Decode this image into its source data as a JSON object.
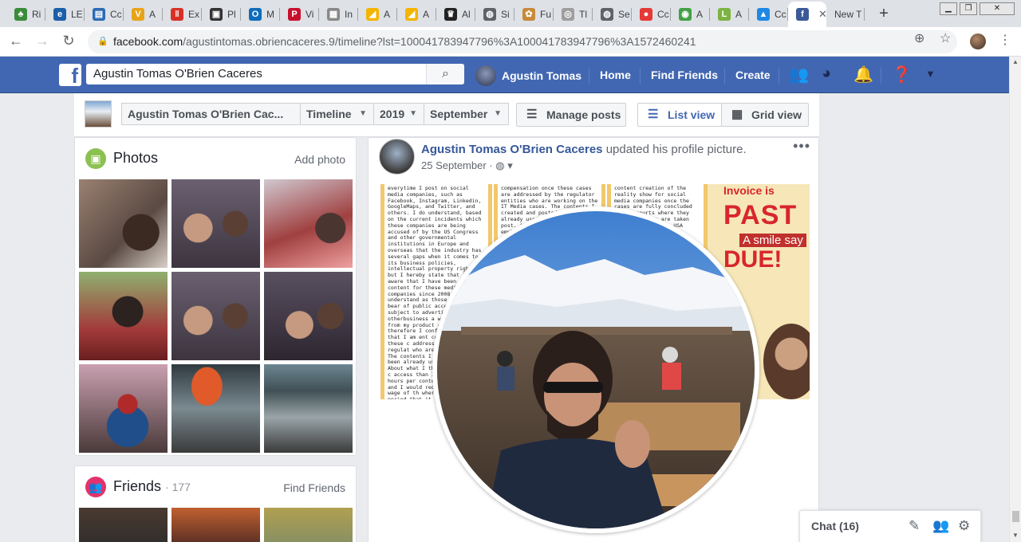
{
  "browser": {
    "tabs": [
      {
        "label": "Ri",
        "color": "#3b8b3b",
        "glyph": "♣"
      },
      {
        "label": "LE",
        "color": "#1c5fa8",
        "glyph": "e"
      },
      {
        "label": "Cc",
        "color": "#2b6bb4",
        "glyph": "▤"
      },
      {
        "label": "A",
        "color": "#e8a317",
        "glyph": "V"
      },
      {
        "label": "Ex",
        "color": "#d93025",
        "glyph": "‖"
      },
      {
        "label": "Pl",
        "color": "#333333",
        "glyph": "▣"
      },
      {
        "label": "M",
        "color": "#0f6cbd",
        "glyph": "O"
      },
      {
        "label": "Vi",
        "color": "#c8102e",
        "glyph": "P"
      },
      {
        "label": "In",
        "color": "#888888",
        "glyph": "▦"
      },
      {
        "label": "A",
        "color": "#f4b400",
        "glyph": "◢"
      },
      {
        "label": "A",
        "color": "#f4b400",
        "glyph": "◢"
      },
      {
        "label": "Al",
        "color": "#222222",
        "glyph": "♛"
      },
      {
        "label": "Si",
        "color": "#5f6368",
        "glyph": "◍"
      },
      {
        "label": "Fu",
        "color": "#c88a3a",
        "glyph": "✿"
      },
      {
        "label": "Tl",
        "color": "#9e9e9e",
        "glyph": "◎"
      },
      {
        "label": "Se",
        "color": "#5f6368",
        "glyph": "◍"
      },
      {
        "label": "Cc",
        "color": "#e53935",
        "glyph": "●"
      },
      {
        "label": "A",
        "color": "#43a047",
        "glyph": "◉"
      },
      {
        "label": "A",
        "color": "#7cb342",
        "glyph": "L"
      },
      {
        "label": "Cc",
        "color": "#1e88e5",
        "glyph": "▲"
      },
      {
        "label": "",
        "color": "#3b5998",
        "glyph": "f"
      },
      {
        "label": "New T",
        "color": "",
        "glyph": ""
      }
    ],
    "url_host": "facebook.com",
    "url_path": "/agustintomas.obriencaceres.9/timeline?lst=100041783947796%3A100041783947796%3A1572460241",
    "new_tab_glyph": "+"
  },
  "fb": {
    "search_value": "Agustin Tomas O'Brien Caceres",
    "user_name": "Agustin Tomas",
    "nav": [
      "Home",
      "Find Friends",
      "Create"
    ]
  },
  "timeline": {
    "name_select": "Agustin Tomas O'Brien Cac...",
    "section_select": "Timeline",
    "year_select": "2019",
    "month_select": "September",
    "manage_posts": "Manage posts",
    "list_view": "List view",
    "grid_view": "Grid view"
  },
  "photos": {
    "title": "Photos",
    "add_link": "Add photo"
  },
  "friends": {
    "title": "Friends",
    "count": "· 177",
    "find_link": "Find Friends"
  },
  "post": {
    "author": "Agustin Tomas O'Brien Caceres",
    "action": "updated his profile picture.",
    "date": "25 September",
    "cover_text_1": "everytime I post on social media companies, such as Facebook, Instagram, Linkedin, GoogleMaps, and Twitter, and others. I do understand, based on the current incidents which these companies are being accused of by the US Congress and other governmental institutions in Europe and overseas that the industry has several gaps when it comes to its business policies, intellectual property rights, but I hereby state that I am aware that I have been creating content for these media companies since 2008 and that I understand as those contents bear of public access and subject to advertising and otherbusiness a which derive from my product content and therefore I conf understanding that I am ent compensation once these c addressed by the regulat who are working on the The contents I created have been already used to post. About what I the employer media c access than I do and 10 to 12 hours per content for online and I would request minimum wage of th where I was/am a n period that it sta since 2008 and on being conducted of and I hereby confi aware and that I o on being considere beneficiaries of c content creation of",
    "cover_text_2": "compensation once these cases are addressed by the regulator entities who are working on the IT Media cases. The contents I created and posted have been already used by the platform to post. About what I request the employer access",
    "cover_text_3": "content creation of the reality show for social media companies once the cases are fully concluded on the courts where they are taken they are taken Argentina, Brazil, USA",
    "invoice_top": "Invoice is",
    "invoice_past": "PAST",
    "invoice_due": "DUE!",
    "invoice_sub": "A smile say"
  },
  "chat": {
    "label": "Chat (16)"
  }
}
